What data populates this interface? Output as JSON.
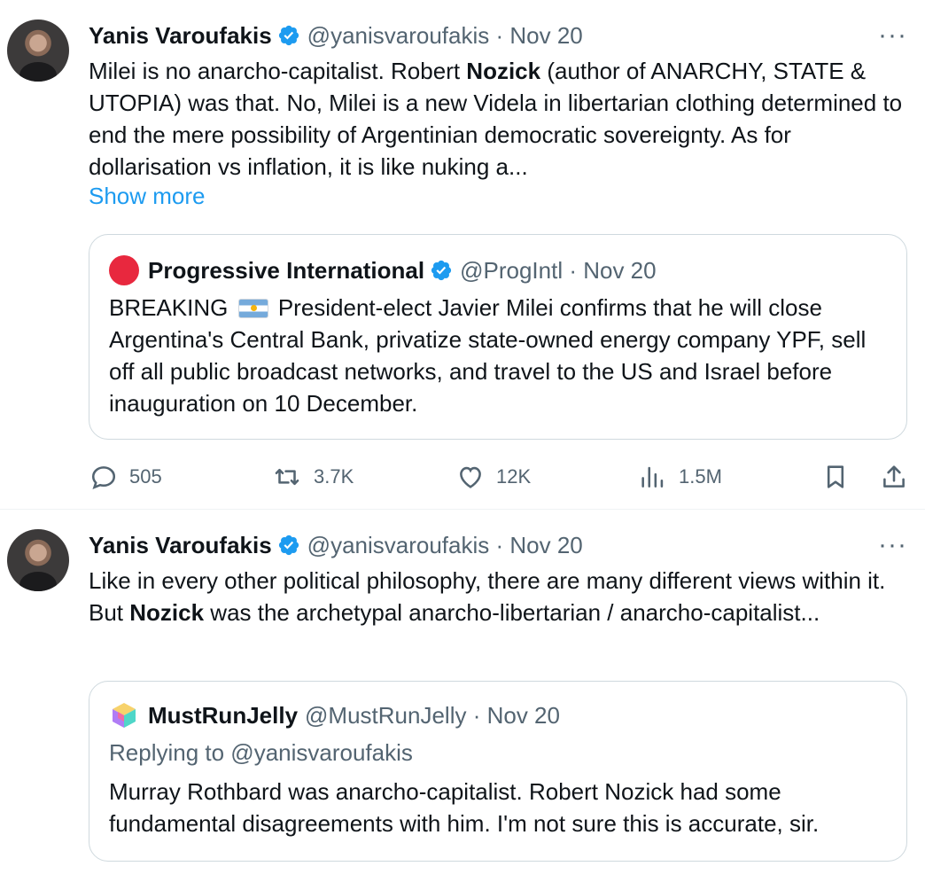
{
  "tweets": [
    {
      "author_name": "Yanis Varoufakis",
      "handle": "@yanisvaroufakis",
      "separator": " · ",
      "date": "Nov 20",
      "text_parts": [
        "Milei is no anarcho-capitalist. Robert ",
        "Nozick",
        " (author of ANARCHY, STATE & UTOPIA) was that. No, Milei is a new Videla in libertarian clothing determined to end the mere possibility of Argentinian democratic sovereignty. As for dollarisation vs inflation, it is like nuking a..."
      ],
      "show_more": "Show more",
      "quote": {
        "author_name": "Progressive International",
        "handle": "@ProgIntl",
        "date": "Nov 20",
        "text_before_flag": "BREAKING ",
        "flag_icon": "argentina-flag-icon",
        "text_after_flag": " President-elect Javier Milei confirms that he will close Argentina's Central Bank, privatize state-owned energy company YPF, sell off all public broadcast networks, and travel to the US and Israel before inauguration on 10 December."
      },
      "actions": {
        "replies": "505",
        "reposts": "3.7K",
        "likes": "12K",
        "views": "1.5M"
      }
    },
    {
      "author_name": "Yanis Varoufakis",
      "handle": "@yanisvaroufakis",
      "separator": " · ",
      "date": "Nov 20",
      "text_parts": [
        "Like in every other political philosophy, there are many different views within it. But ",
        "Nozick",
        " was the archetypal anarcho-libertarian / anarcho-capitalist..."
      ],
      "quote": {
        "author_name": "MustRunJelly",
        "handle": "@MustRunJelly",
        "date": "Nov 20",
        "replying_to": "Replying to @yanisvaroufakis",
        "text": "Murray Rothbard was anarcho-capitalist. Robert Nozick had some fundamental disagreements with him.  I'm not sure this is accurate, sir."
      }
    }
  ],
  "more_glyph": "···",
  "colors": {
    "link": "#1d9bf0",
    "verified": "#1d9bf0",
    "muted": "#536471",
    "border": "#cfd9de",
    "prog_red": "#e8283e"
  }
}
